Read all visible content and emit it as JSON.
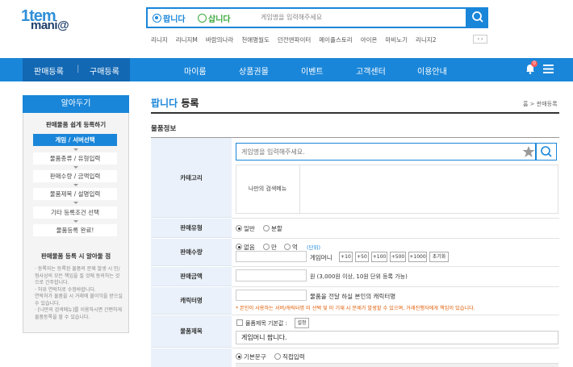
{
  "logo": {
    "line1": "1tem",
    "line2": "mani@"
  },
  "search": {
    "sell_label": "팝니다",
    "buy_label": "삽니다",
    "placeholder": "게임명을 입력해주세요"
  },
  "games": [
    "리니지",
    "리니지M",
    "바람의나라",
    "천애명월도",
    "던전앤파이터",
    "메이플스토리",
    "아이온",
    "마비노기",
    "리니지2"
  ],
  "game_nav": "‹ ›",
  "nav": {
    "left": [
      "판매등록",
      "구매등록"
    ],
    "sep": "|",
    "items": [
      "마이룸",
      "상품권몰",
      "이벤트",
      "고객센터",
      "이용안내"
    ],
    "bell_count": "0"
  },
  "sidebar": {
    "title": "알아두기",
    "guide_title": "판매물품 쉽게 등록하기",
    "steps": [
      "게임 / 서버선택",
      "물품종류 / 유형입력",
      "판매수량 / 금액입력",
      "물품제목 / 설명입력",
      "기타 등록조건 선택",
      "물품등록 완료!"
    ],
    "notice_title": "판매물품 등록 시 알아둘 점",
    "notes": [
      "· 등록자는 등록된 물품의 문제 발생 시 민/형사상의 모든 책임을 질 것에 동의하는 것으로 간주합니다.",
      "· 허위 연락처로 수정바랍니다.",
      "  연락처가 물품을 시 거래에 불이익을 받으실 수 있습니다.",
      "· [나만의 검색메뉴]를 이용하시면 간편하게 물품등록을 할 수 있습니다."
    ]
  },
  "page": {
    "title_blue": "팝니다",
    "title_rest": "등록",
    "breadcrumb": "홈 > 판매등록",
    "section": "물품정보"
  },
  "form": {
    "category_label": "카테고리",
    "category_placeholder": "게임명을 입력해주세요.",
    "my_search_menu": "나만의 검색메뉴",
    "sale_type_label": "판매유형",
    "sale_type_options": [
      "일반",
      "분할"
    ],
    "quantity_label": "판매수량",
    "quantity_units": [
      "없음",
      "만",
      "억"
    ],
    "quantity_unit_hint": "(단위)",
    "quantity_suffix": "게임머니",
    "quantity_buttons": [
      "+10",
      "+50",
      "+100",
      "+500",
      "+1000",
      "초기화"
    ],
    "price_label": "판매금액",
    "price_suffix": "원 (3,000원 이상, 10원 단위 등록 가능)",
    "character_label": "캐릭터명",
    "character_suffix": "물품을 전달 하실 본인의 캐릭터명",
    "character_warning": "* 본인이 사용하는 서버/캐릭터명 미 선택 및 미 기재 시 문제가 발생할 수 있으며, 거래진행자에게 책임이 있습니다.",
    "title_label": "물품제목",
    "title_default_check": "물품제목 기본값 :",
    "title_setting_btn": "설정",
    "title_value": "게임머니 팝니다.",
    "desc_options": [
      "기본문구",
      "직접입력"
    ]
  },
  "colors": {
    "primary": "#1a86d9",
    "nav_dark": "#1368b4",
    "label_bg": "#eaf1fa",
    "warning": "#e05a00",
    "unit_hint": "#1a86d9"
  }
}
